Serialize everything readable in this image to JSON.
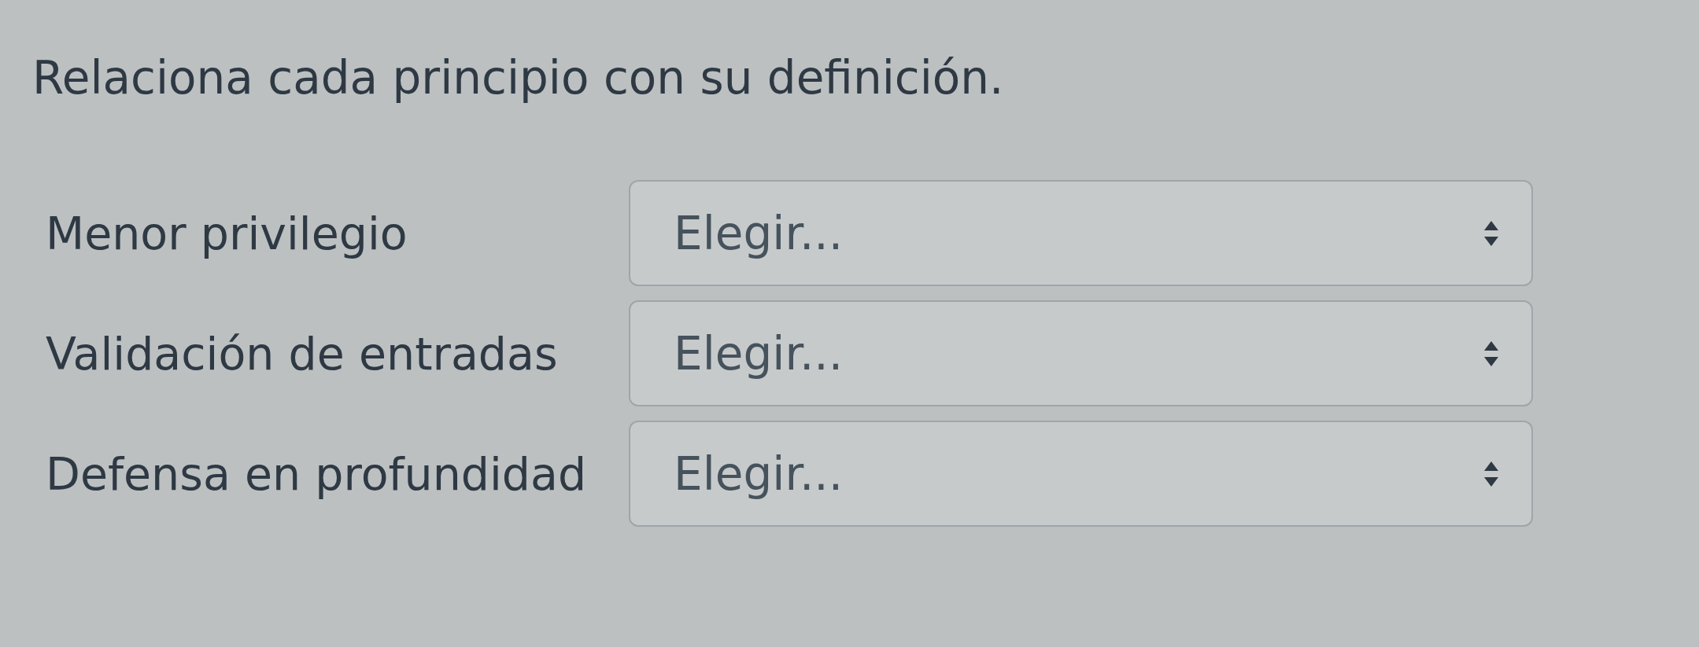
{
  "title": "Relaciona cada principio con su definición.",
  "rows": [
    {
      "term": "Menor privilegio",
      "select": {
        "placeholder": "Elegir..."
      }
    },
    {
      "term": "Validación de entradas",
      "select": {
        "placeholder": "Elegir..."
      }
    },
    {
      "term": "Defensa en profundidad",
      "select": {
        "placeholder": "Elegir..."
      }
    }
  ]
}
